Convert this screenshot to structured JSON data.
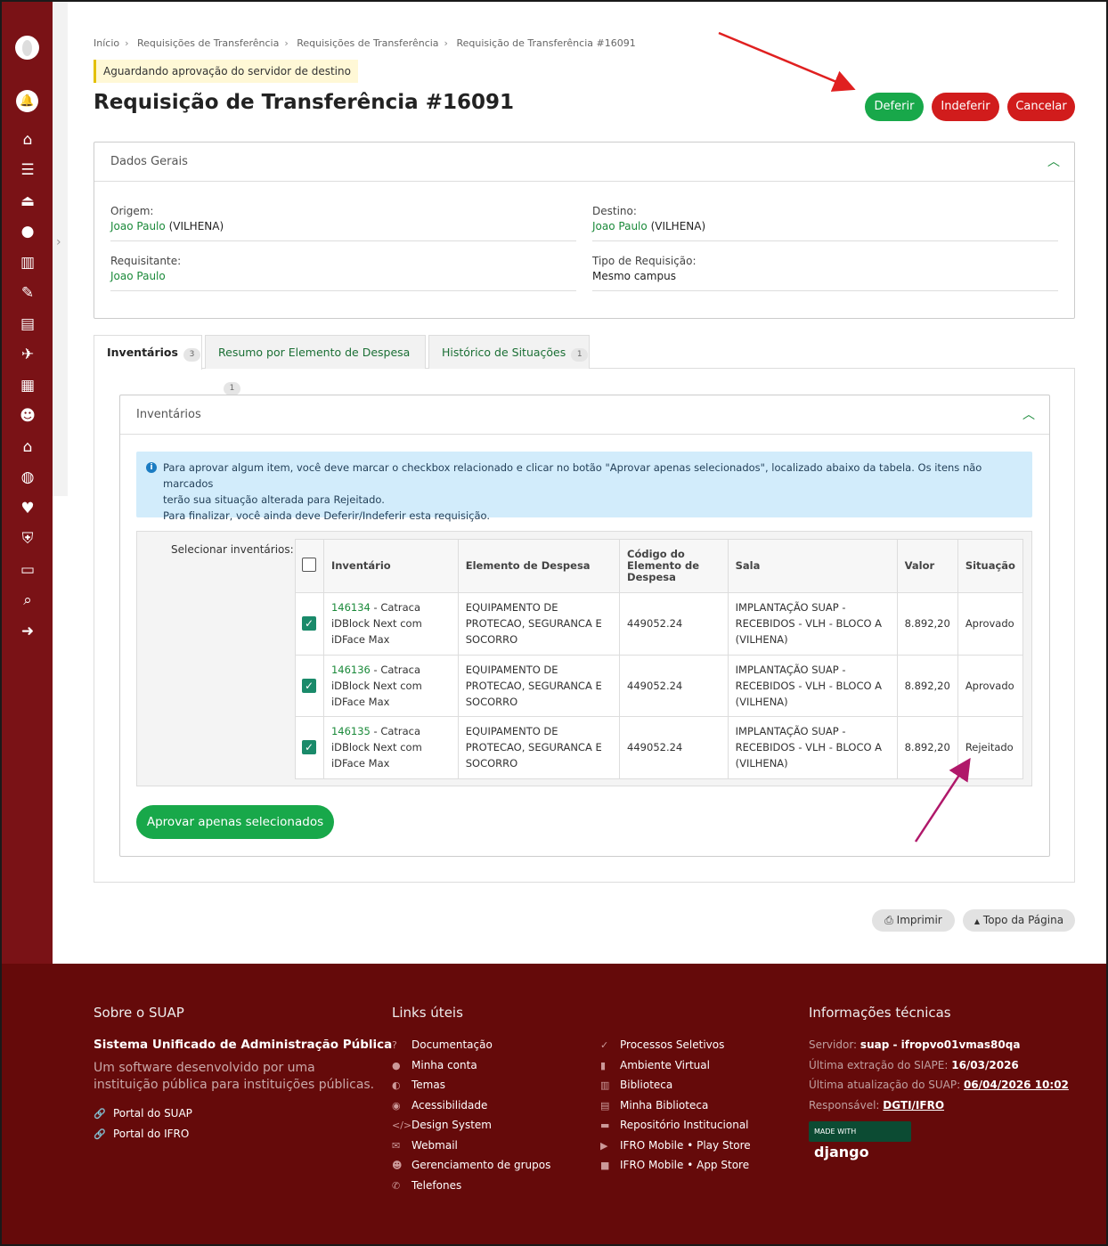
{
  "breadcrumb": [
    "Início",
    "Requisições de Transferência",
    "Requisições de Transferência",
    "Requisição de Transferência #16091"
  ],
  "status": "Aguardando aprovação do servidor de destino",
  "title": "Requisição de Transferência #16091",
  "actions": {
    "approve": "Deferir",
    "reject": "Indeferir",
    "cancel": "Cancelar"
  },
  "general": {
    "heading": "Dados Gerais",
    "origin_label": "Origem:",
    "origin_link": "Joao Paulo",
    "origin_rest": "(VILHENA)",
    "dest_label": "Destino:",
    "dest_link": "Joao Paulo",
    "dest_rest": "(VILHENA)",
    "requester_label": "Requisitante:",
    "requester_link": "Joao Paulo",
    "type_label": "Tipo de Requisição:",
    "type_value": "Mesmo campus"
  },
  "tabs": [
    {
      "label": "Inventários",
      "count": "3"
    },
    {
      "label": "Resumo por Elemento de Despesa",
      "count": "1"
    },
    {
      "label": "Histórico de Situações",
      "count": "1"
    }
  ],
  "inventory": {
    "heading": "Inventários",
    "info_line1": "Para aprovar algum item, você deve marcar o checkbox relacionado e clicar no botão \"Aprovar apenas selecionados\", localizado abaixo da tabela. Os itens não marcados",
    "info_line2": "terão sua situação alterada para Rejeitado.",
    "info_line3": "Para finalizar, você ainda deve Deferir/Indeferir esta requisição.",
    "select_label": "Selecionar inventários:",
    "columns": [
      "Inventário",
      "Elemento de Despesa",
      "Código do Elemento de Despesa",
      "Sala",
      "Valor",
      "Situação"
    ],
    "rows": [
      {
        "num": "146134",
        "desc": " - Catraca iDBlock Next com iDFace Max",
        "element": "EQUIPAMENTO DE PROTECAO, SEGURANCA E SOCORRO",
        "code": "449052.24",
        "room": "IMPLANTAÇÃO SUAP - RECEBIDOS - VLH - BLOCO A (VILHENA)",
        "value": "8.892,20",
        "status": "Aprovado"
      },
      {
        "num": "146136",
        "desc": " - Catraca iDBlock Next com iDFace Max",
        "element": "EQUIPAMENTO DE PROTECAO, SEGURANCA E SOCORRO",
        "code": "449052.24",
        "room": "IMPLANTAÇÃO SUAP - RECEBIDOS - VLH - BLOCO A (VILHENA)",
        "value": "8.892,20",
        "status": "Aprovado"
      },
      {
        "num": "146135",
        "desc": " - Catraca iDBlock Next com iDFace Max",
        "element": "EQUIPAMENTO DE PROTECAO, SEGURANCA E SOCORRO",
        "code": "449052.24",
        "room": "IMPLANTAÇÃO SUAP - RECEBIDOS - VLH - BLOCO A (VILHENA)",
        "value": "8.892,20",
        "status": "Rejeitado"
      }
    ],
    "approve_selected": "Aprovar apenas selecionados"
  },
  "utility": {
    "print": "Imprimir",
    "top": "Topo da Página"
  },
  "footer": {
    "about_heading": "Sobre o SUAP",
    "about_title": "Sistema Unificado de Administração Pública",
    "about_desc1": "Um software desenvolvido por uma",
    "about_desc2": "instituição pública para instituições públicas.",
    "portal_suap": "Portal do SUAP",
    "portal_ifro": "Portal do IFRO",
    "links_heading": "Links úteis",
    "links_col1": [
      "Documentação",
      "Minha conta",
      "Temas",
      "Acessibilidade",
      "Design System",
      "Webmail",
      "Gerenciamento de grupos",
      "Telefones"
    ],
    "links_col2": [
      "Processos Seletivos",
      "Ambiente Virtual",
      "Biblioteca",
      "Minha Biblioteca",
      "Repositório Institucional",
      "IFRO Mobile • Play Store",
      "IFRO Mobile • App Store"
    ],
    "tech_heading": "Informações técnicas",
    "server_label": "Servidor:",
    "server_value": "suap - ifropvo01vmas80qa",
    "siape_label": "Última extração do SIAPE:",
    "siape_value": "16/03/2026",
    "update_label": "Última atualização do SUAP:",
    "update_value": "06/04/2026 10:02",
    "resp_label": "Responsável:",
    "resp_value": "DGTI/IFRO",
    "django_small": "MADE WITH",
    "django_big": "django"
  },
  "colors": {
    "sidebar": "#7a1216",
    "footer": "#650a0a",
    "green": "#18a84a",
    "red": "#d11c1c"
  }
}
